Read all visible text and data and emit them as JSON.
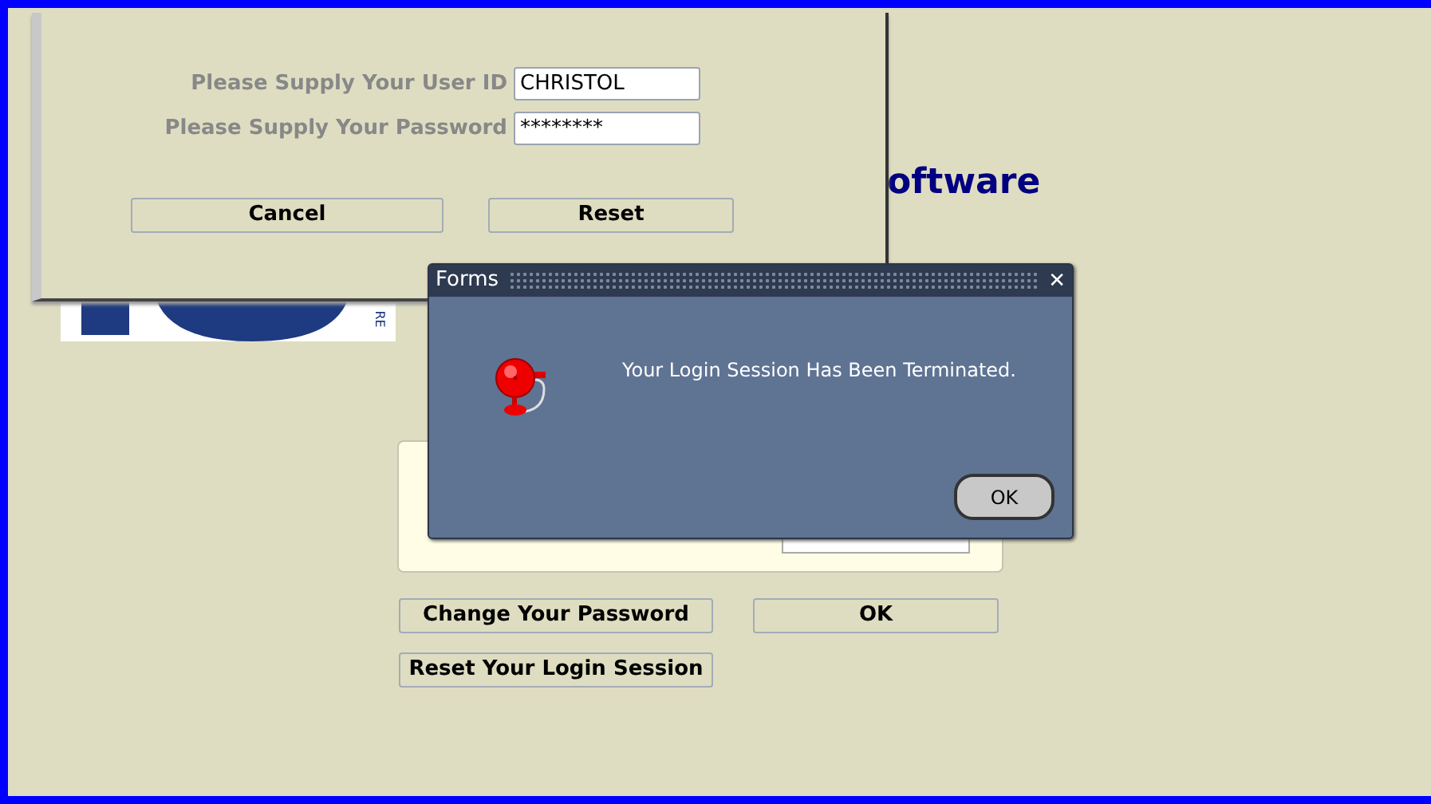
{
  "login_window": {
    "fields": [
      {
        "label": "Please Supply Your User ID",
        "value": "CHRISTOL"
      },
      {
        "label": "Please Supply Your Password",
        "value": "********"
      }
    ],
    "buttons": [
      "Cancel",
      "Reset"
    ]
  },
  "logo": {
    "fragment_text": "RE"
  },
  "heading_fragment": "oftware",
  "session_panel": {
    "buttons": [
      "Change Your Password",
      "OK",
      "Reset Your Login Session"
    ]
  },
  "dialog": {
    "title": "Forms",
    "message": "Your Login Session Has Been Terminated.",
    "button": "OK",
    "close": "✕"
  }
}
